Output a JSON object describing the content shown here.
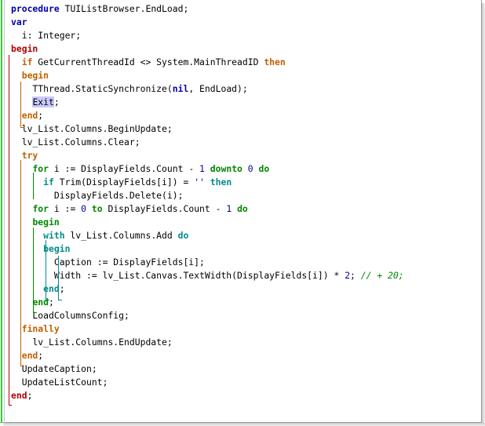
{
  "editor": {
    "lines": [
      [
        {
          "t": "procedure",
          "c": "kw"
        },
        {
          "t": " TUIListBrowser.EndLoad;",
          "c": ""
        }
      ],
      [
        {
          "t": "var",
          "c": "kw"
        }
      ],
      [
        {
          "t": "  i: Integer;",
          "c": ""
        }
      ],
      [
        {
          "t": "begin",
          "c": "kw-red"
        }
      ],
      [
        {
          "t": "  ",
          "c": ""
        },
        {
          "t": "if",
          "c": "kw-orange"
        },
        {
          "t": " GetCurrentThreadId <> System.MainThreadID ",
          "c": ""
        },
        {
          "t": "then",
          "c": "kw-orange"
        }
      ],
      [
        {
          "t": "  ",
          "c": ""
        },
        {
          "t": "begin",
          "c": "kw-orange"
        }
      ],
      [
        {
          "t": "    TThread.StaticSynchronize(",
          "c": ""
        },
        {
          "t": "nil",
          "c": "kw"
        },
        {
          "t": ", EndLoad);",
          "c": ""
        }
      ],
      [
        {
          "t": "    ",
          "c": ""
        },
        {
          "t": "Exit",
          "c": "hl"
        },
        {
          "t": ";",
          "c": ""
        }
      ],
      [
        {
          "t": "  ",
          "c": ""
        },
        {
          "t": "end",
          "c": "kw-orange"
        },
        {
          "t": ";",
          "c": ""
        }
      ],
      [
        {
          "t": "  lv_List.Columns.BeginUpdate;",
          "c": ""
        }
      ],
      [
        {
          "t": "  lv_List.Columns.Clear;",
          "c": ""
        }
      ],
      [
        {
          "t": "  ",
          "c": ""
        },
        {
          "t": "try",
          "c": "kw-orange"
        }
      ],
      [
        {
          "t": "    ",
          "c": ""
        },
        {
          "t": "for",
          "c": "kw-green"
        },
        {
          "t": " i := DisplayFields.Count - ",
          "c": ""
        },
        {
          "t": "1",
          "c": "num"
        },
        {
          "t": " ",
          "c": ""
        },
        {
          "t": "downto",
          "c": "kw-green"
        },
        {
          "t": " ",
          "c": ""
        },
        {
          "t": "0",
          "c": "num"
        },
        {
          "t": " ",
          "c": ""
        },
        {
          "t": "do",
          "c": "kw-green"
        }
      ],
      [
        {
          "t": "      ",
          "c": ""
        },
        {
          "t": "if",
          "c": "kw-teal"
        },
        {
          "t": " Trim(DisplayFields[i]) = ",
          "c": ""
        },
        {
          "t": "''",
          "c": "str"
        },
        {
          "t": " ",
          "c": ""
        },
        {
          "t": "then",
          "c": "kw-teal"
        }
      ],
      [
        {
          "t": "        DisplayFields.Delete(i);",
          "c": ""
        }
      ],
      [
        {
          "t": "    ",
          "c": ""
        },
        {
          "t": "for",
          "c": "kw-green"
        },
        {
          "t": " i := ",
          "c": ""
        },
        {
          "t": "0",
          "c": "num"
        },
        {
          "t": " ",
          "c": ""
        },
        {
          "t": "to",
          "c": "kw-green"
        },
        {
          "t": " DisplayFields.Count - ",
          "c": ""
        },
        {
          "t": "1",
          "c": "num"
        },
        {
          "t": " ",
          "c": ""
        },
        {
          "t": "do",
          "c": "kw-green"
        }
      ],
      [
        {
          "t": "    ",
          "c": ""
        },
        {
          "t": "begin",
          "c": "kw-green"
        }
      ],
      [
        {
          "t": "      ",
          "c": ""
        },
        {
          "t": "with",
          "c": "kw-teal"
        },
        {
          "t": " lv_List.Columns.Add ",
          "c": ""
        },
        {
          "t": "do",
          "c": "kw-teal"
        }
      ],
      [
        {
          "t": "      ",
          "c": ""
        },
        {
          "t": "begin",
          "c": "kw-teal"
        }
      ],
      [
        {
          "t": "        Caption := DisplayFields[i];",
          "c": ""
        }
      ],
      [
        {
          "t": "        Width := lv_List.Canvas.TextWidth(DisplayFields[i]) * ",
          "c": ""
        },
        {
          "t": "2",
          "c": "num"
        },
        {
          "t": "; ",
          "c": ""
        },
        {
          "t": "// + 20;",
          "c": "cm"
        }
      ],
      [
        {
          "t": "      ",
          "c": ""
        },
        {
          "t": "end",
          "c": "kw-teal"
        },
        {
          "t": ";",
          "c": ""
        }
      ],
      [
        {
          "t": "    ",
          "c": ""
        },
        {
          "t": "end",
          "c": "kw-green"
        },
        {
          "t": ";",
          "c": ""
        }
      ],
      [
        {
          "t": "    LoadColumnsConfig;",
          "c": ""
        }
      ],
      [
        {
          "t": "  ",
          "c": ""
        },
        {
          "t": "finally",
          "c": "kw-orange"
        }
      ],
      [
        {
          "t": "    lv_List.Columns.EndUpdate;",
          "c": ""
        }
      ],
      [
        {
          "t": "  ",
          "c": ""
        },
        {
          "t": "end",
          "c": "kw-orange"
        },
        {
          "t": ";",
          "c": ""
        }
      ],
      [
        {
          "t": "  UpdateCaption;",
          "c": ""
        }
      ],
      [
        {
          "t": "  UpdateListCount;",
          "c": ""
        }
      ],
      [
        {
          "t": "end",
          "c": "kw-red"
        },
        {
          "t": ";",
          "c": ""
        }
      ]
    ]
  },
  "colors": {
    "gutter_change_bar": "#2fd32f",
    "structure_outer": "#b30000",
    "structure_level1": "#c06000",
    "structure_level2": "#008800",
    "structure_level3": "#008b8b",
    "selection_highlight": "#c8c8ff"
  }
}
